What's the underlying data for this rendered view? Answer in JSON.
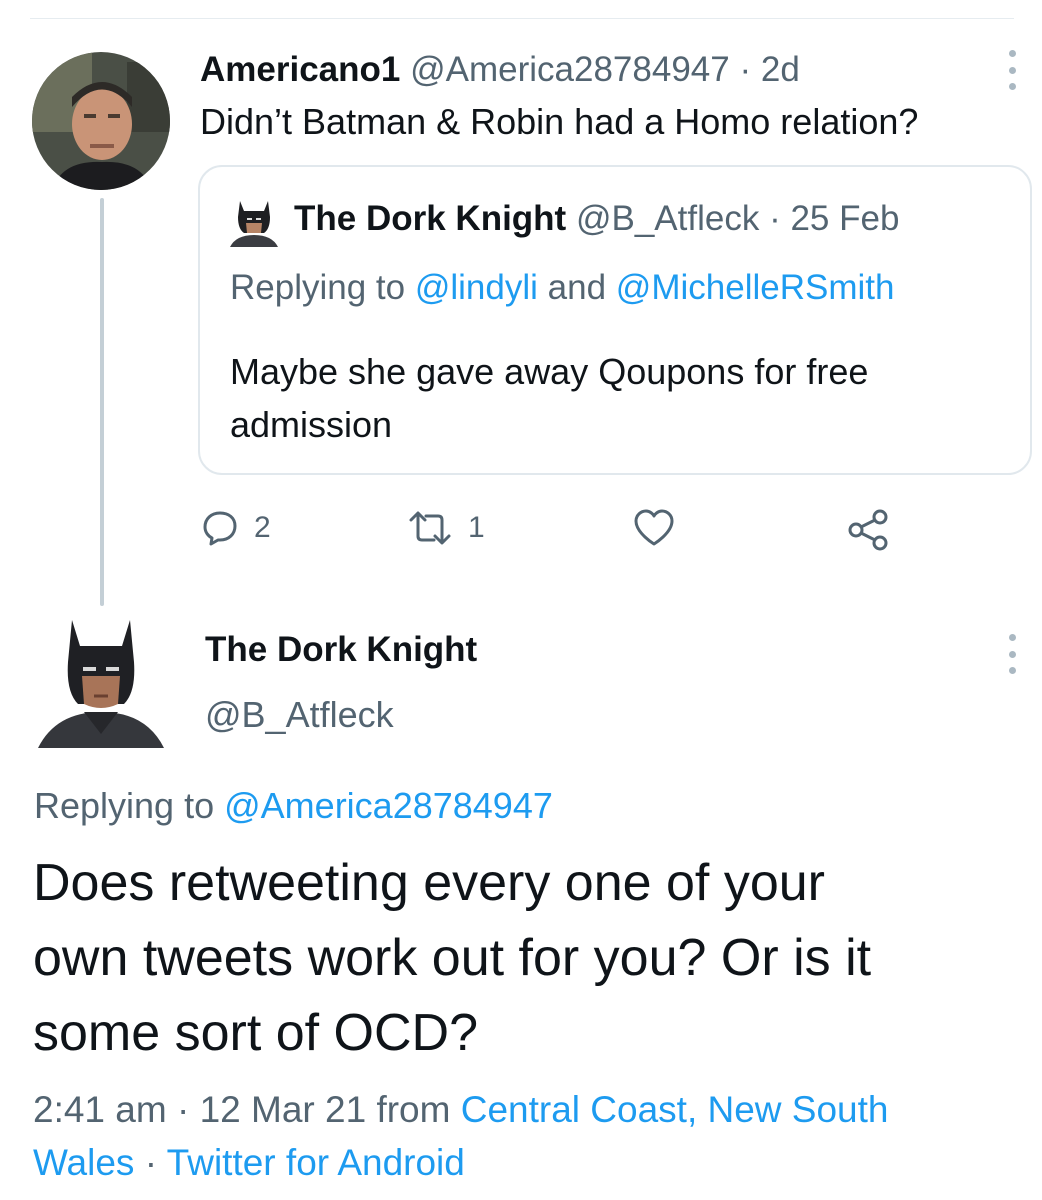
{
  "parent_tweet": {
    "author_name": "Americano1",
    "handle": "@America28784947",
    "separator": "·",
    "time": "2d",
    "text": "Didn’t Batman & Robin had a Homo relation?",
    "quoted": {
      "author_name": "The Dork Knight",
      "handle": "@B_Atfleck",
      "separator": "·",
      "date": "25 Feb",
      "replying_prefix": "Replying to",
      "reply_user_1": "@lindyli",
      "reply_and": "and",
      "reply_user_2": "@MichelleRSmith",
      "text_line1": "Maybe she gave away Qoupons for free",
      "text_line2": "admission"
    },
    "actions": {
      "reply_icon": "reply-icon",
      "reply_count": "2",
      "retweet_icon": "retweet-icon",
      "retweet_count": "1",
      "like_icon": "heart-icon",
      "share_icon": "share-icon"
    }
  },
  "main_tweet": {
    "author_name": "The Dork Knight",
    "handle": "@B_Atfleck",
    "replying_prefix": "Replying to",
    "reply_user": "@America28784947",
    "text_line1": "Does retweeting every one of your",
    "text_line2": "own tweets work out for you? Or is it",
    "text_line3": "some sort of OCD?",
    "timestamp": "2:41 am · 12 Mar 21 from",
    "location_line1": "Central Coast, New South",
    "location_line2": "Wales",
    "source_separator": "·",
    "source": "Twitter for Android"
  },
  "colors": {
    "accent": "#1d9bf0",
    "text": "#0f1419",
    "secondary": "#536471",
    "thread_line": "#c4cfd6"
  }
}
